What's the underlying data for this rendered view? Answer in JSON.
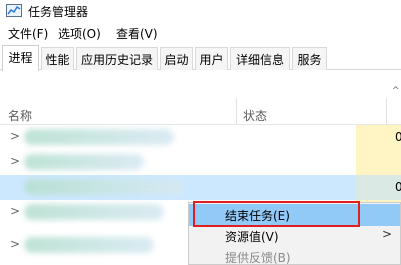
{
  "window": {
    "title": "任务管理器"
  },
  "menu": {
    "file": "文件(F)",
    "options": "选项(O)",
    "view": "查看(V)"
  },
  "tabs": [
    {
      "label": "进程"
    },
    {
      "label": "性能"
    },
    {
      "label": "应用历史记录"
    },
    {
      "label": "启动"
    },
    {
      "label": "用户"
    },
    {
      "label": "详细信息"
    },
    {
      "label": "服务"
    }
  ],
  "columns": {
    "name": "名称",
    "status": "状态"
  },
  "rows": [
    {
      "chevron": ">",
      "cpu": "0"
    },
    {
      "chevron": ">",
      "cpu": ""
    },
    {
      "chevron": "",
      "cpu": "0"
    },
    {
      "chevron": ">",
      "cpu": ""
    },
    {
      "chevron": ">",
      "cpu": ""
    }
  ],
  "context_menu": {
    "items": [
      {
        "label": "结束任务(E)"
      },
      {
        "label": "资源值(V)",
        "arrow": ">"
      },
      {
        "label": "提供反馈(B)"
      }
    ]
  },
  "colors": {
    "selection": "#cce8ff",
    "menu_hover": "#91c9f7",
    "highlight": "#e02020",
    "cpu_fill": "#fff4c4"
  }
}
